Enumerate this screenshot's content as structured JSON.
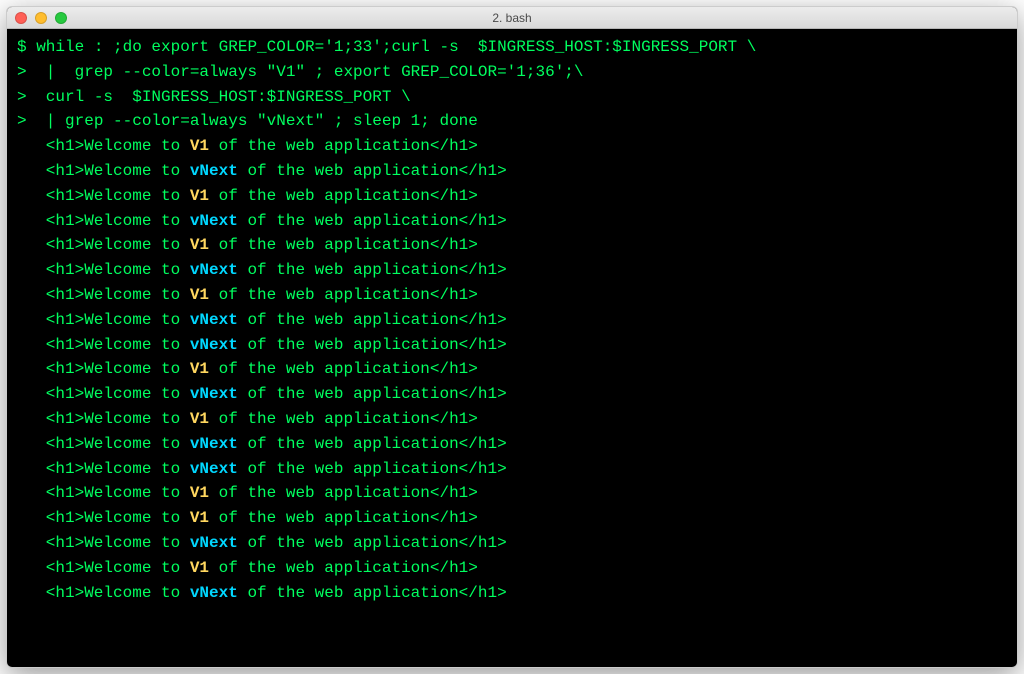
{
  "window": {
    "title": "2. bash"
  },
  "colors": {
    "term_green": "#00ff5f",
    "hl_yellow": "#ffd75f",
    "hl_cyan": "#00d7ff"
  },
  "prompt_lines": [
    {
      "ps": "$ ",
      "text": "while : ;do export GREP_COLOR='1;33';curl -s  $INGRESS_HOST:$INGRESS_PORT \\"
    },
    {
      "ps": ">  ",
      "text": "|  grep --color=always \"V1\" ; export GREP_COLOR='1;36';\\"
    },
    {
      "ps": ">  ",
      "text": "curl -s  $INGRESS_HOST:$INGRESS_PORT \\"
    },
    {
      "ps": ">  ",
      "text": "| grep --color=always \"vNext\" ; sleep 1; done"
    }
  ],
  "output_template": {
    "pre": "<h1>Welcome to ",
    "post": " of the web application</h1>"
  },
  "output_tokens": [
    "V1",
    "vNext",
    "V1",
    "vNext",
    "V1",
    "vNext",
    "V1",
    "vNext",
    "vNext",
    "V1",
    "vNext",
    "V1",
    "vNext",
    "vNext",
    "V1",
    "V1",
    "vNext",
    "V1",
    "vNext"
  ]
}
